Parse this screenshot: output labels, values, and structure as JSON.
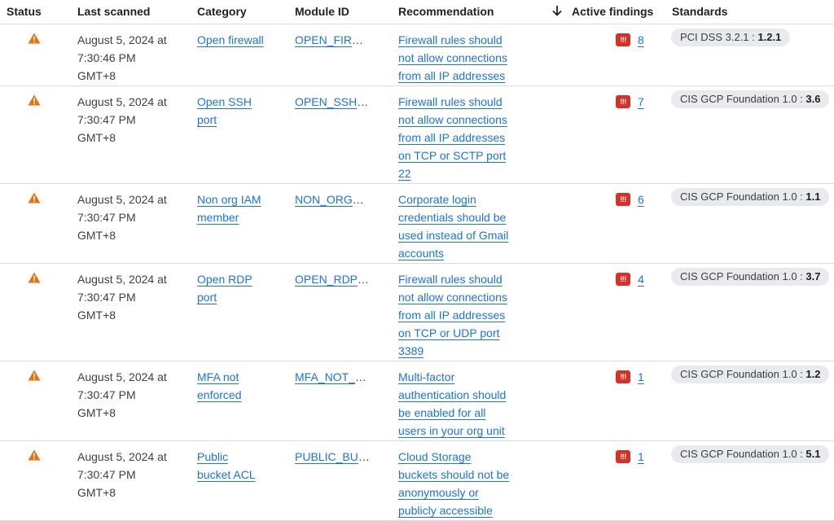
{
  "columns": {
    "status": "Status",
    "last_scanned": "Last scanned",
    "category": "Category",
    "module_id": "Module ID",
    "recommendation": "Recommendation",
    "active_findings": "Active findings",
    "standards": "Standards"
  },
  "sort_icon": "arrow-down-icon",
  "status_icon": "warning-triangle-icon",
  "severity_icon": "critical-severity-icon",
  "severity_text": "!!!",
  "colors": {
    "link": "#1a73e8",
    "warning": "#e8710a",
    "severity": "#d93025",
    "chip": "#e8eaed"
  },
  "rows": [
    {
      "scanned": [
        "August 5, 2024 at",
        "7:30:46 PM",
        "GMT+8"
      ],
      "category": [
        "Open firewall"
      ],
      "module_id": "OPEN_FIRE…",
      "recommendation": [
        "Firewall rules should",
        "not allow connections",
        "from all IP addresses"
      ],
      "findings": "8",
      "standard_name": "PCI DSS 3.2.1 : ",
      "standard_id": "1.2.1"
    },
    {
      "scanned": [
        "August 5, 2024 at",
        "7:30:47 PM",
        "GMT+8"
      ],
      "category": [
        "Open SSH",
        "port"
      ],
      "module_id": "OPEN_SSH_…",
      "recommendation": [
        "Firewall rules should",
        "not allow connections",
        "from all IP addresses",
        "on TCP or SCTP port",
        "22"
      ],
      "findings": "7",
      "standard_name": "CIS GCP Foundation 1.0 : ",
      "standard_id": "3.6"
    },
    {
      "scanned": [
        "August 5, 2024 at",
        "7:30:47 PM",
        "GMT+8"
      ],
      "category": [
        "Non org IAM",
        "member"
      ],
      "module_id": "NON_ORG_I…",
      "recommendation": [
        "Corporate login",
        "credentials should be",
        "used instead of Gmail",
        "accounts"
      ],
      "findings": "6",
      "standard_name": "CIS GCP Foundation 1.0 : ",
      "standard_id": "1.1"
    },
    {
      "scanned": [
        "August 5, 2024 at",
        "7:30:47 PM",
        "GMT+8"
      ],
      "category": [
        "Open RDP",
        "port"
      ],
      "module_id": "OPEN_RDP_…",
      "recommendation": [
        "Firewall rules should",
        "not allow connections",
        "from all IP addresses",
        "on TCP or UDP port",
        "3389"
      ],
      "findings": "4",
      "standard_name": "CIS GCP Foundation 1.0 : ",
      "standard_id": "3.7"
    },
    {
      "scanned": [
        "August 5, 2024 at",
        "7:30:47 PM",
        "GMT+8"
      ],
      "category": [
        "MFA not",
        "enforced"
      ],
      "module_id": "MFA_NOT_E…",
      "recommendation": [
        "Multi-factor",
        "authentication should",
        "be enabled for all",
        "users in your org unit"
      ],
      "findings": "1",
      "standard_name": "CIS GCP Foundation 1.0 : ",
      "standard_id": "1.2"
    },
    {
      "scanned": [
        "August 5, 2024 at",
        "7:30:47 PM",
        "GMT+8"
      ],
      "category": [
        "Public",
        "bucket ACL"
      ],
      "module_id": "PUBLIC_BUC…",
      "recommendation": [
        "Cloud Storage",
        "buckets should not be",
        "anonymously or",
        "publicly accessible"
      ],
      "findings": "1",
      "standard_name": "CIS GCP Foundation 1.0 : ",
      "standard_id": "5.1"
    }
  ]
}
